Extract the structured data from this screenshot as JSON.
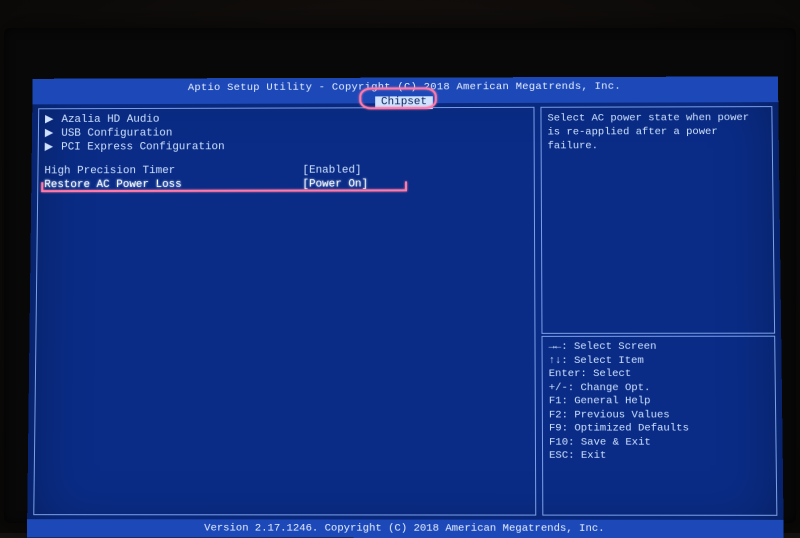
{
  "title_line": "Aptio Setup Utility - Copyright (C) 2018 American Megatrends, Inc.",
  "active_tab": "Chipset",
  "submenus": [
    "Azalia HD Audio",
    "USB Configuration",
    "PCI Express Configuration"
  ],
  "options": [
    {
      "label": "High Precision Timer",
      "value": "[Enabled]",
      "selected": false
    },
    {
      "label": "Restore AC Power Loss",
      "value": "[Power On]",
      "selected": true
    }
  ],
  "help_text": "Select AC power state when power is re-applied after a power failure.",
  "hotkeys": [
    "→←: Select Screen",
    "↑↓: Select Item",
    "Enter: Select",
    "+/-: Change Opt.",
    "F1: General Help",
    "F2: Previous Values",
    "F9: Optimized Defaults",
    "F10: Save & Exit",
    "ESC: Exit"
  ],
  "footer_line": "Version 2.17.1246. Copyright (C) 2018 American Megatrends, Inc."
}
